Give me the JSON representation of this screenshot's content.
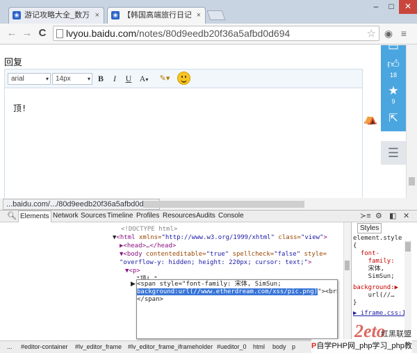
{
  "browser": {
    "tabs": [
      {
        "label": "游记攻略大全_数万精彩旅",
        "close": "×"
      },
      {
        "label": "【韩国高端旅行日记】好",
        "close": "×"
      }
    ],
    "window_controls": {
      "minimize": "–",
      "maximize": "□",
      "close": "✕"
    },
    "nav": {
      "back": "←",
      "forward": "→",
      "reload": "C"
    },
    "url": {
      "host": "lvyou.baidu.com",
      "path": "/notes/80d9eedb20f36a5afbd0d694"
    },
    "star": "☆",
    "menu": "≡"
  },
  "page": {
    "reply_label": "回复",
    "editor": {
      "font_family": "arial",
      "font_size": "14px",
      "bold": "B",
      "italic": "I",
      "underline": "U",
      "font_color": "A",
      "dropdown_arrow": "▾",
      "content": "顶!"
    },
    "sidebar": {
      "like_count": "18",
      "favorite_count": "9"
    }
  },
  "status_url": "...baidu.com/.../80d9eedb20f36a5afbd0d694",
  "devtools": {
    "tabs": [
      "Elements",
      "Network",
      "Sources",
      "Timeline",
      "Profiles",
      "Resources",
      "Audits",
      "Console"
    ],
    "dom_lines": {
      "l0": "<!DOCTYPE html>",
      "l1_tag_open": "<html",
      "l1_attr1": " xmlns=",
      "l1_val1": "\"http://www.w3.org/1999/xhtml\"",
      "l1_attr2": " class=",
      "l1_val2": "\"view\"",
      "l1_close": ">",
      "l2": "▶<head>…</head>",
      "l3_open": "▼<body",
      "l3_attr1": " contenteditable=",
      "l3_val1": "\"true\"",
      "l3_attr2": " spellcheck=",
      "l3_val2": "\"false\"",
      "l3_attr3": " style=",
      "l4_val": "\"overflow-y: hidden; height: 220px; cursor: text;\"",
      "l4_close": ">",
      "l5": "▼<p>",
      "l6": "\"顶! \"",
      "l7_tag": "<span style=\"font-family: 宋体, SimSun;",
      "l8_sel": "background:url(//www.etherdream.com/xss/pic.png)",
      "l8_rest": "\"><br>",
      "l9": "</span>"
    },
    "styles": {
      "tab": "Styles",
      "l1": "element.style",
      "l2": "{",
      "l3": "  font-",
      "l4": "    family:",
      "l5": "    宋体,",
      "l6": "    SimSun;",
      "l7": "background:▶",
      "l8": "    url(//…",
      "l9": "}",
      "l10": "▶ iframe.css:1"
    },
    "breadcrumbs": [
      "...",
      "#editor-container",
      "#lv_editor_frame",
      "#lv_editor_frame_iframeholder",
      "#ueditor_0",
      "html",
      "body",
      "p"
    ]
  },
  "watermark": {
    "logo": "2eto",
    "brand": "红黑联盟",
    "text_p": "P",
    "text": "自学PHP网_php学习_php教"
  }
}
